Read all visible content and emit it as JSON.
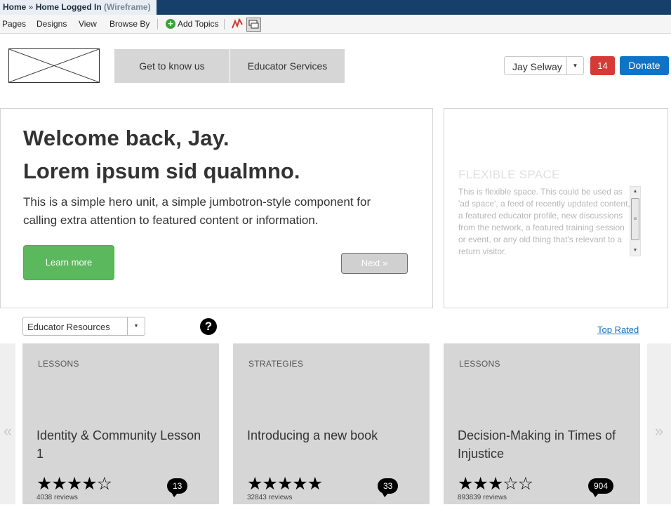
{
  "titlebar": {
    "crumb_home": "Home",
    "crumb_sep": " » ",
    "crumb_page": "Home Logged In",
    "crumb_suffix": " (Wireframe)"
  },
  "menubar": {
    "items": [
      "Pages",
      "Designs",
      "View",
      "Browse By"
    ],
    "add_topics": "Add Topics"
  },
  "header": {
    "nav_tabs": [
      "Get to know us",
      "Educator Services"
    ],
    "user_name": "Jay Selway",
    "notification_count": "14",
    "donate_label": "Donate"
  },
  "hero": {
    "heading_1": "Welcome back, Jay.",
    "heading_2": "Lorem ipsum sid qualmno.",
    "body": "This is a simple hero unit, a simple jumbotron-style component for calling extra attention to featured content or information.",
    "learn_more_label": "Learn more",
    "next_label": "Next »"
  },
  "flexible_space": {
    "title": "FLEXIBLE SPACE",
    "text": "This is flexible space. This could be used as 'ad space', a feed of recently updated content, a featured educator profile, new discussions from the network, a featured training session or event, or any old thing that's relevant to a return visitor."
  },
  "filters": {
    "resource_select_value": "Educator Resources",
    "help_icon_glyph": "?",
    "top_rated_label": "Top Rated"
  },
  "carousel": {
    "prev_glyph": "«",
    "next_glyph": "»",
    "cards": [
      {
        "category": "LESSONS",
        "title": "Identity & Community Lesson 1",
        "stars": "★★★★☆",
        "rating": 4,
        "reviews": "4038 reviews",
        "comments": "13"
      },
      {
        "category": "STRATEGIES",
        "title": "Introducing a new book",
        "stars": "★★★★★",
        "rating": 5,
        "reviews": "32843 reviews",
        "comments": "33"
      },
      {
        "category": "LESSONS",
        "title": "Decision-Making in Times of Injustice",
        "stars": "★★★☆☆",
        "rating": 3,
        "reviews": "893839 reviews",
        "comments": "904"
      }
    ]
  }
}
